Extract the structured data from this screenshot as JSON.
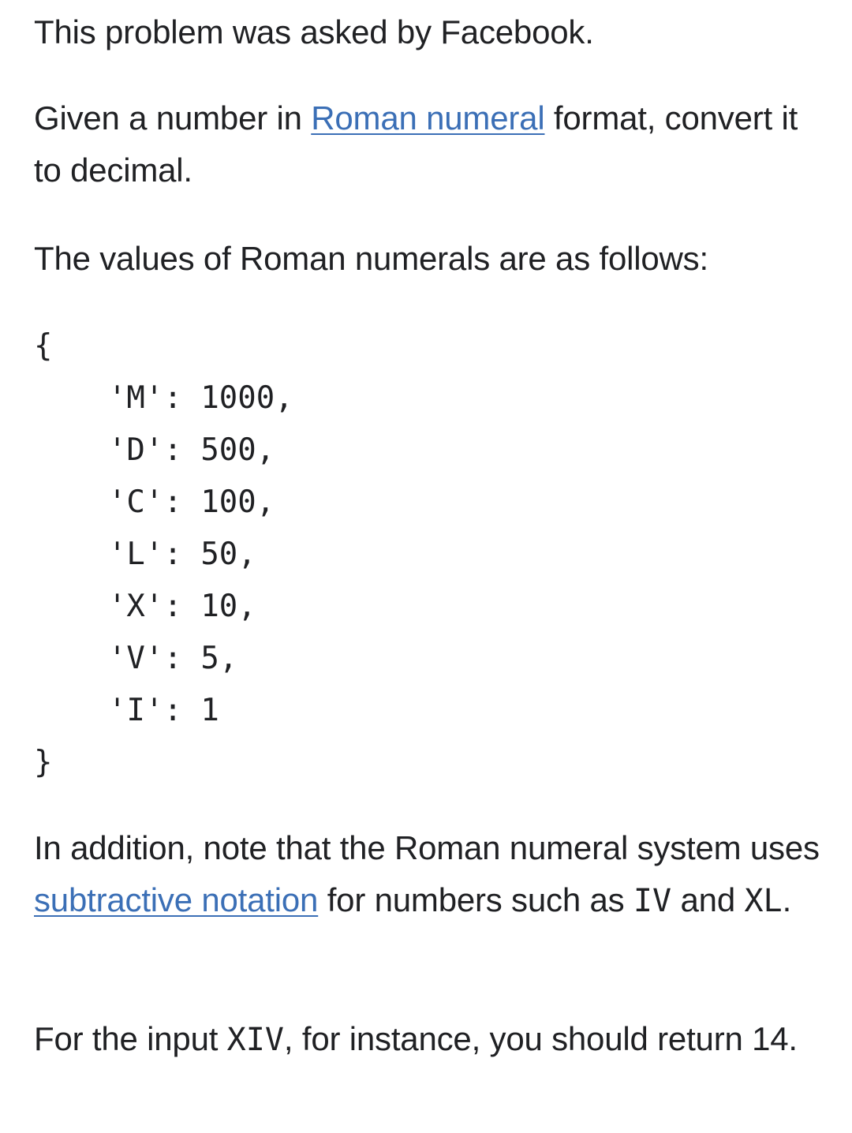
{
  "paragraphs": {
    "intro": "This problem was asked by Facebook.",
    "given_before": "Given a number in ",
    "given_link": "Roman numeral",
    "given_after": " format, convert it to decimal.",
    "values_intro": "The values of Roman numerals are as follows:",
    "addition_before": "In addition, note that the Roman numeral system uses ",
    "addition_link": "subtractive notation",
    "addition_middle": " for numbers such as ",
    "addition_code1": "IV",
    "addition_and": " and ",
    "addition_code2": "XL",
    "addition_end": ".",
    "example_before": "For the input ",
    "example_code": "XIV",
    "example_after": ", for instance, you should return 14."
  },
  "code_block": {
    "open": "{",
    "lines": [
      "    'M': 1000,",
      "    'D': 500,",
      "    'C': 100,",
      "    'L': 50,",
      "    'X': 10,",
      "    'V': 5,",
      "    'I': 1"
    ],
    "close": "}"
  },
  "colors": {
    "text": "#202124",
    "link": "#3b6fb6",
    "background": "#ffffff"
  }
}
